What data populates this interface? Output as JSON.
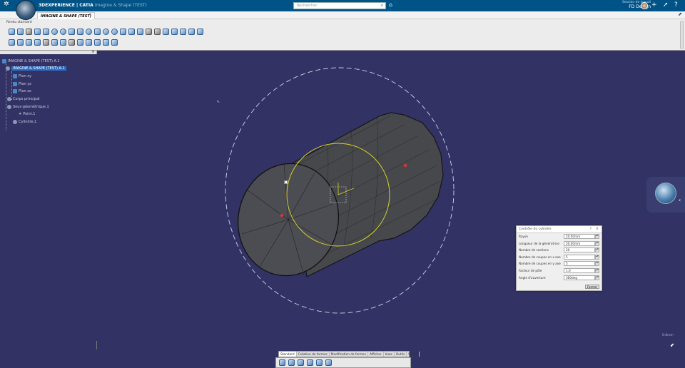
{
  "topbar": {
    "brand": "3DEXPERIENCE | CATIA",
    "subtitle": "Imagine & Shape (TEST)",
    "search_placeholder": "Rechercher",
    "role": "Session de travail",
    "user": "FD Design"
  },
  "tabs": {
    "active": "IMAGINE & SHAPE (TEST)",
    "add": "+"
  },
  "ribbon": {
    "section_label": "Rendu standard"
  },
  "tree": {
    "root": "IMAGINE & SHAPE (TEST) A.1",
    "part": "IMAGINE & SHAPE (TEST) A.1",
    "items": [
      "Plan xy",
      "Plan yz",
      "Plan zx",
      "Corps principal",
      "Sous-géométrique.1",
      "Point.1",
      "Cylindre.1"
    ]
  },
  "dialog": {
    "title": "Contrôle du cylindre",
    "rows": [
      {
        "label": "Rayon",
        "value": "20.00mm"
      },
      {
        "label": "Longueur de la génératrice",
        "value": "50.00mm"
      },
      {
        "label": "Nombre de sections",
        "value": "20"
      },
      {
        "label": "Nombre de coupes en x axe",
        "value": "5"
      },
      {
        "label": "Nombre de coupes en y axe",
        "value": "5"
      },
      {
        "label": "Facteur de pôle",
        "value": "1.0"
      },
      {
        "label": "Angle d'ouverture",
        "value": "360deg"
      }
    ],
    "close": "Fermer"
  },
  "bottom_tabs": [
    "Standard",
    "Création de formes",
    "Modification de formes",
    "Afficher",
    "Vues",
    "Outils",
    "Sortie"
  ],
  "scale_label": "0.0mm",
  "colors": {
    "topbar": "#005386",
    "viewport": "#323364",
    "selection": "#d8d22a"
  }
}
